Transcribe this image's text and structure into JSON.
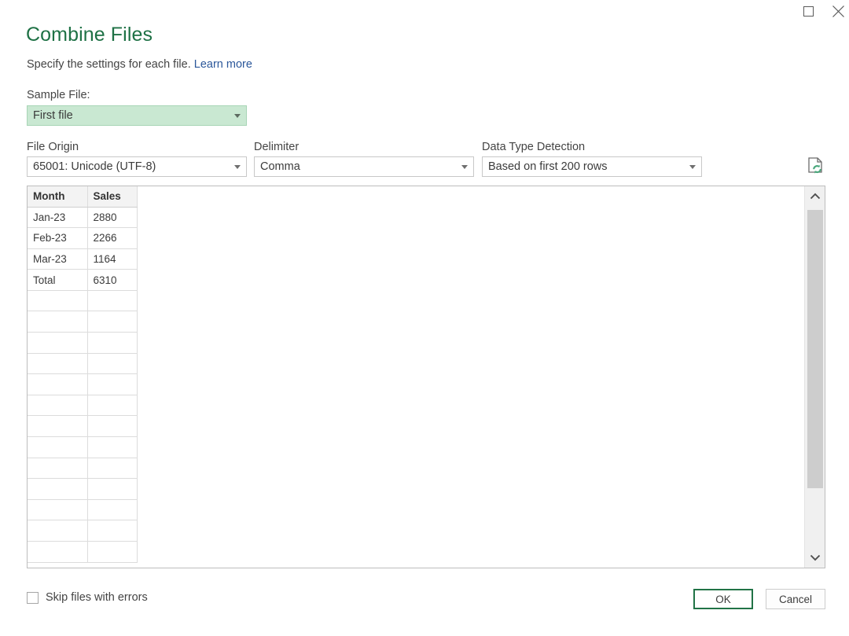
{
  "window": {
    "maximize_icon": "maximize-square-icon",
    "close_icon": "close-x-icon"
  },
  "header": {
    "title": "Combine Files",
    "subtitle": "Specify the settings for each file.",
    "learn_more": "Learn more",
    "title_color": "#1e7145",
    "link_color": "#2b579a"
  },
  "fields": {
    "sample_file": {
      "label": "Sample File:",
      "value": "First file",
      "highlight_color": "#c9e8d2"
    },
    "file_origin": {
      "label": "File Origin",
      "value": "65001: Unicode (UTF-8)"
    },
    "delimiter": {
      "label": "Delimiter",
      "value": "Comma"
    },
    "data_type_detection": {
      "label": "Data Type Detection",
      "value": "Based on first 200 rows"
    },
    "refresh_icon": "page-refresh-icon"
  },
  "preview": {
    "columns": [
      "Month",
      "Sales"
    ],
    "rows": [
      [
        "Jan-23",
        "2880"
      ],
      [
        "Feb-23",
        "2266"
      ],
      [
        "Mar-23",
        "1164"
      ],
      [
        "Total",
        "6310"
      ]
    ],
    "empty_row_count": 13,
    "scrollbar": {
      "up_icon": "chevron-up-icon",
      "down_icon": "chevron-down-icon"
    }
  },
  "footer": {
    "skip_files_label": "Skip files with errors",
    "skip_files_checked": false,
    "ok_label": "OK",
    "cancel_label": "Cancel",
    "ok_border_color": "#217346"
  }
}
